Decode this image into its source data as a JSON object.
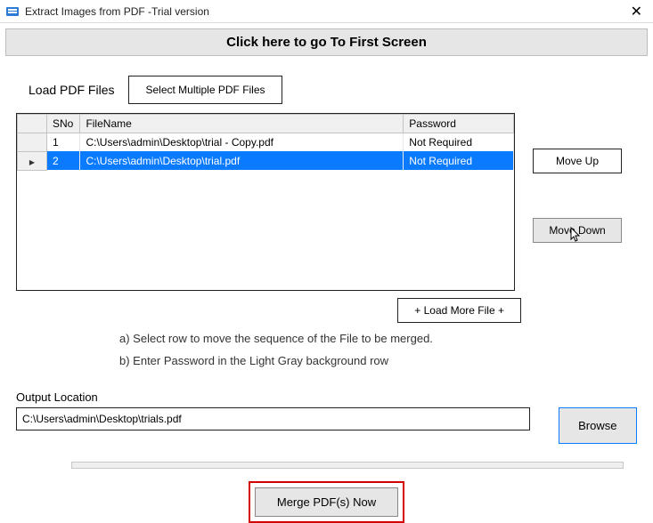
{
  "window": {
    "title": "Extract Images from PDF -Trial version",
    "close": "✕"
  },
  "banner": "Click here to go To First Screen",
  "load": {
    "label": "Load PDF Files",
    "select_button": "Select Multiple PDF Files"
  },
  "grid": {
    "headers": {
      "sno": "SNo",
      "fname": "FileName",
      "pwd": "Password"
    },
    "rows": [
      {
        "sno": "1",
        "fname": "C:\\Users\\admin\\Desktop\\trial - Copy.pdf",
        "pwd": "Not Required",
        "selected": false
      },
      {
        "sno": "2",
        "fname": "C:\\Users\\admin\\Desktop\\trial.pdf",
        "pwd": "Not Required",
        "selected": true
      }
    ]
  },
  "side": {
    "moveup": "Move Up",
    "movedown": "Move Down"
  },
  "loadmore": "+ Load More File +",
  "hints": {
    "a": "a) Select row to move the sequence of the File to be merged.",
    "b": "b) Enter Password in the Light Gray background row"
  },
  "output": {
    "label": "Output Location",
    "value": "C:\\Users\\admin\\Desktop\\trials.pdf",
    "browse": "Browse"
  },
  "merge": "Merge  PDF(s) Now"
}
